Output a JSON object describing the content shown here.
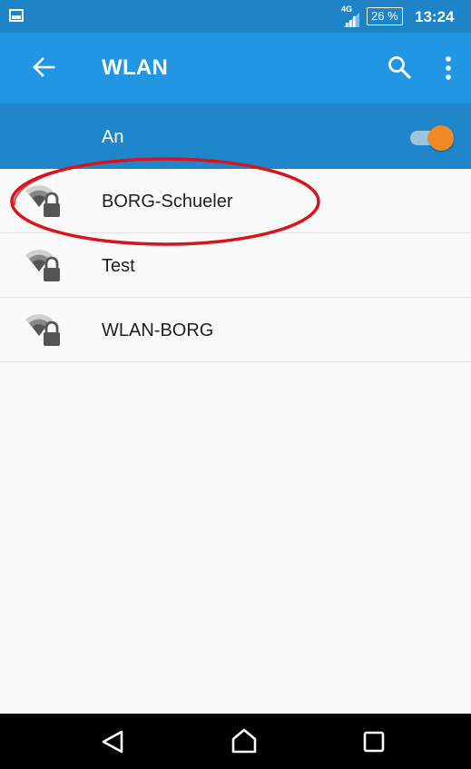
{
  "status_bar": {
    "network": "4G",
    "battery": "26 %",
    "time": "13:24"
  },
  "action_bar": {
    "title": "WLAN",
    "back_icon": "arrow-left-icon",
    "search_icon": "search-icon",
    "more_icon": "more-vertical-icon"
  },
  "switch": {
    "label": "An",
    "state": "on"
  },
  "wlan": {
    "networks": [
      {
        "name": "BORG-Schueler",
        "secured": true
      },
      {
        "name": "Test",
        "secured": true
      },
      {
        "name": "WLAN-BORG",
        "secured": true
      }
    ]
  },
  "colors": {
    "status_bar": "#1f83c8",
    "action_bar": "#2196e3",
    "switch_bar": "#1f86cc",
    "toggle_thumb": "#f08a24",
    "annotation": "#d9141a"
  }
}
